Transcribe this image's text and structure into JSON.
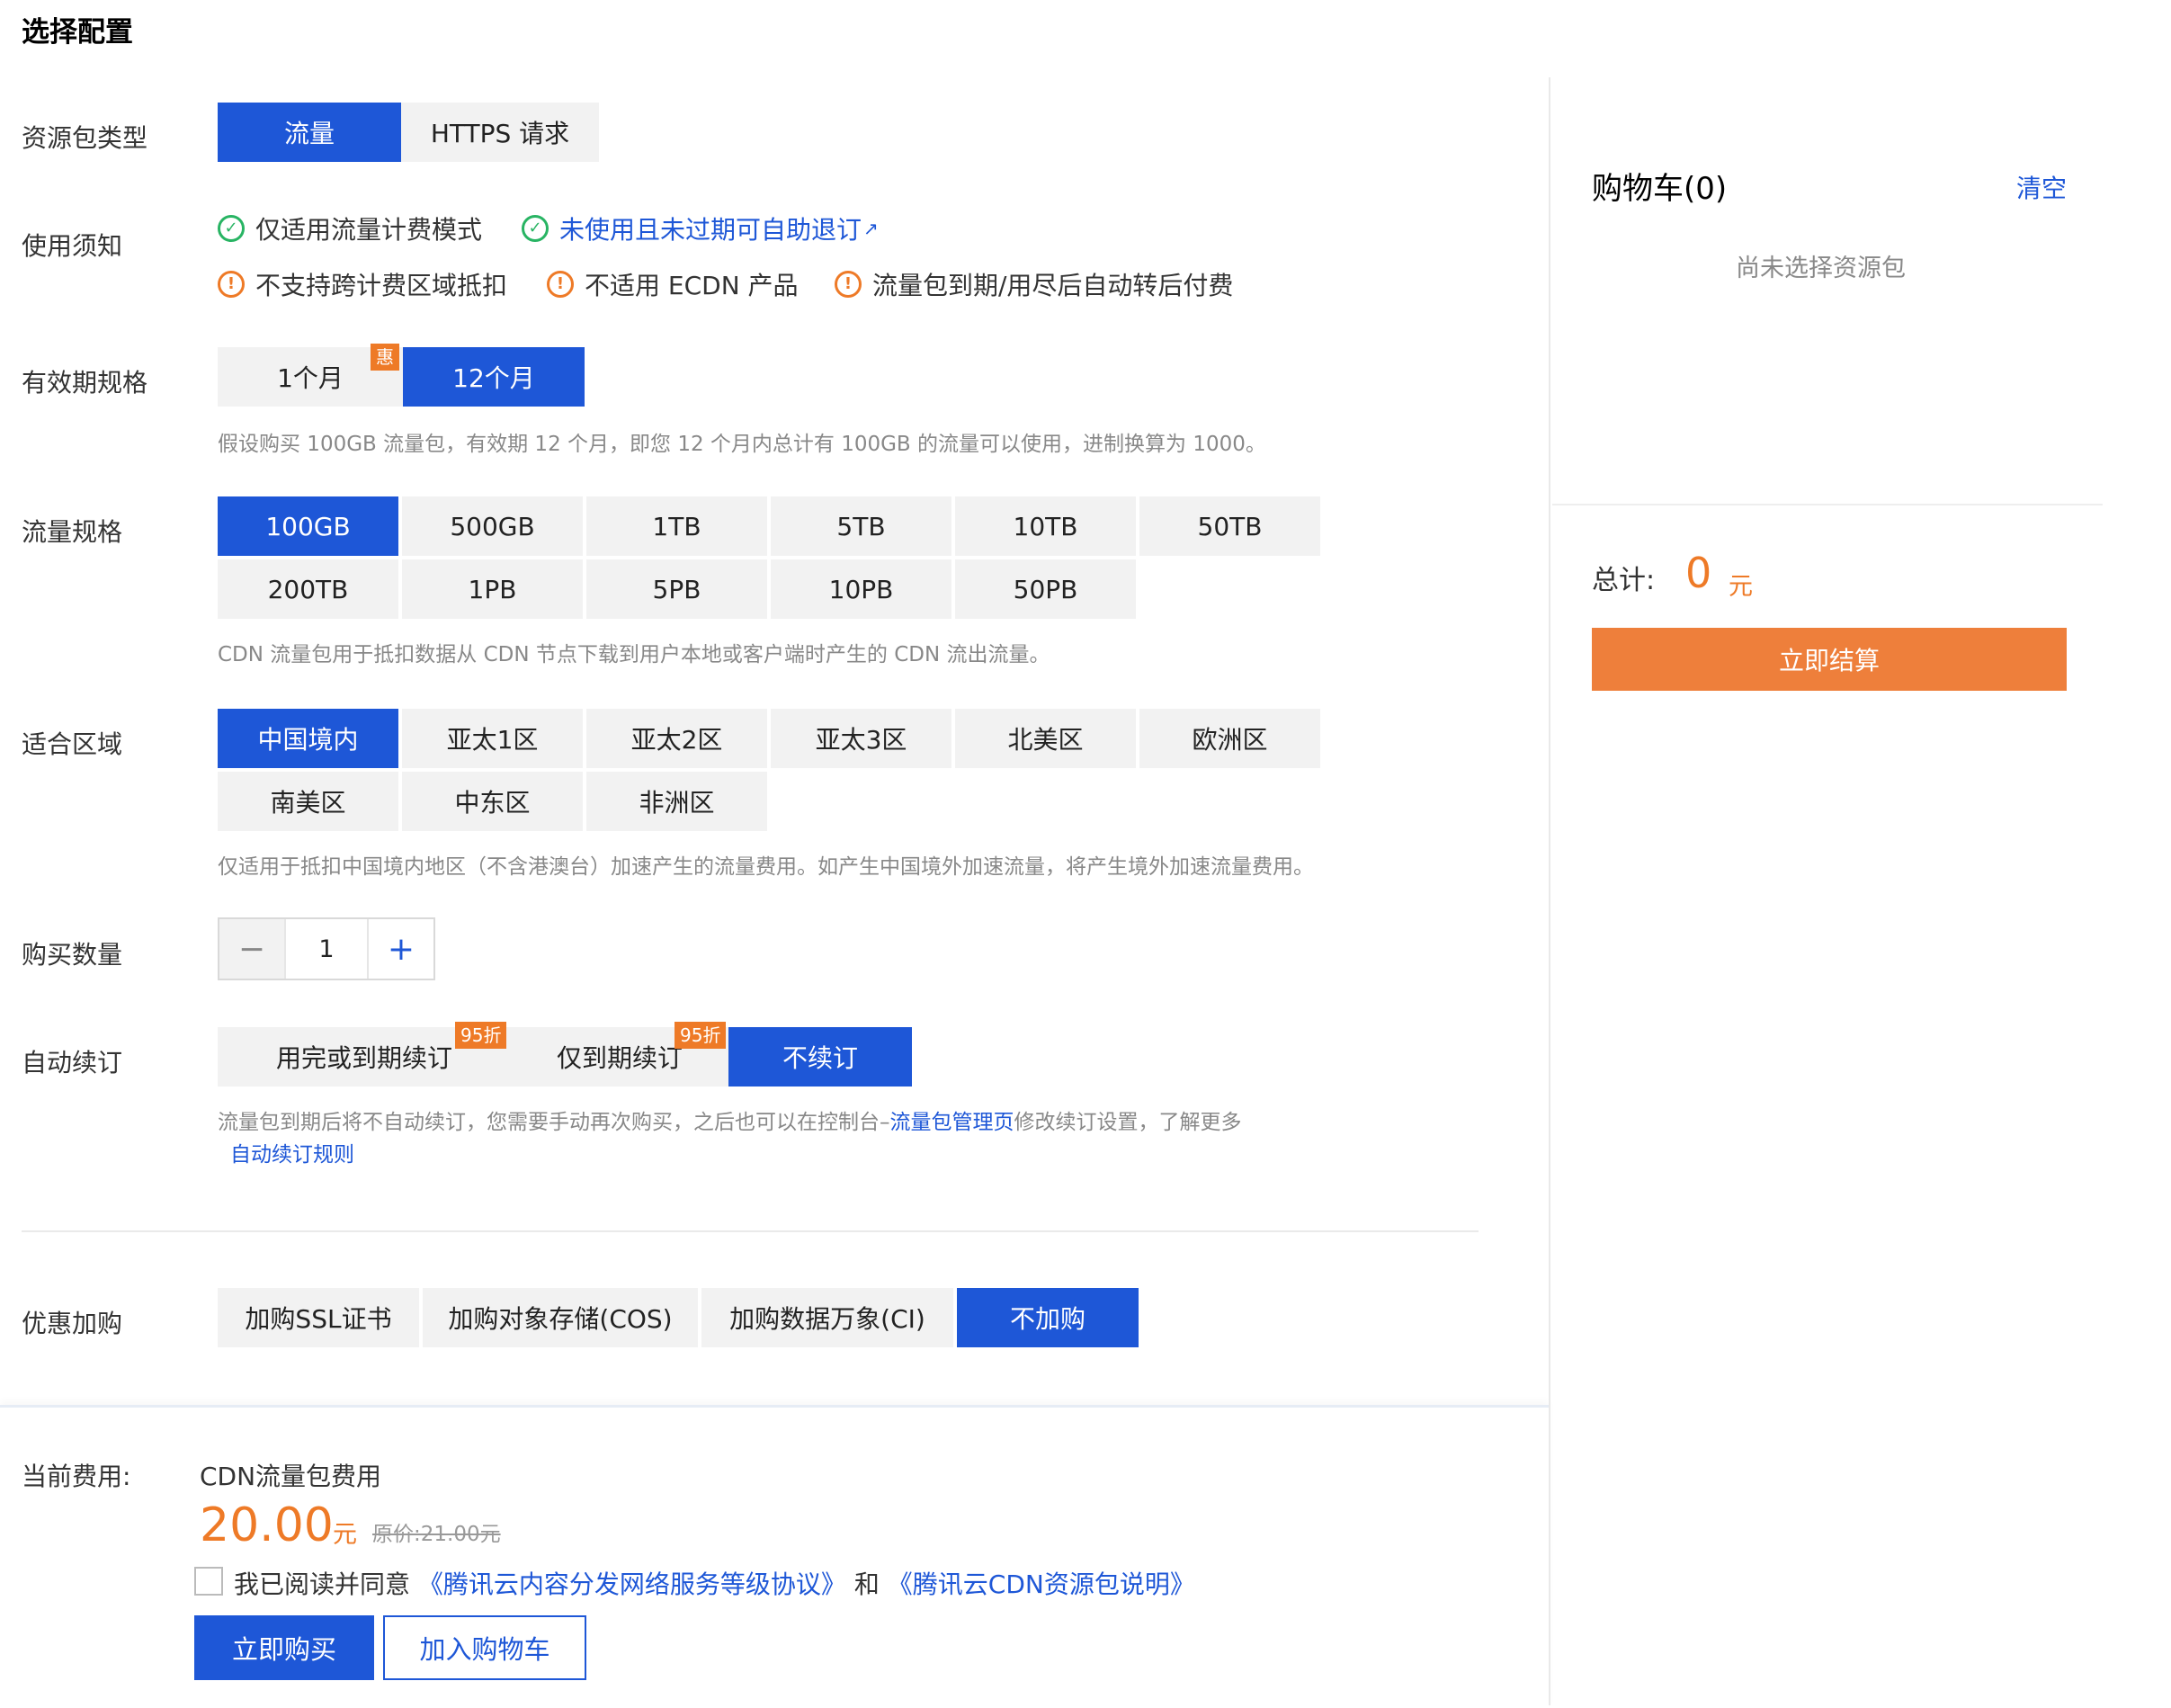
{
  "page_title": "选择配置",
  "package_type": {
    "label": "资源包类型",
    "options": [
      "流量",
      "HTTPS 请求"
    ],
    "selected": "流量"
  },
  "notice": {
    "label": "使用须知",
    "items": [
      {
        "icon": "check-circle-icon",
        "text": "仅适用流量计费模式"
      },
      {
        "icon": "check-circle-icon",
        "text": "未使用且未过期可自助退订",
        "link": true
      },
      {
        "icon": "warning-circle-icon",
        "text": "不支持跨计费区域抵扣"
      },
      {
        "icon": "warning-circle-icon",
        "text": "不适用 ECDN 产品"
      },
      {
        "icon": "warning-circle-icon",
        "text": "流量包到期/用尽后自动转后付费"
      }
    ]
  },
  "validity": {
    "label": "有效期规格",
    "options": [
      "1个月",
      "12个月"
    ],
    "badge": "惠",
    "selected": "12个月",
    "hint": "假设购买 100GB 流量包，有效期 12 个月，即您 12 个月内总计有 100GB 的流量可以使用，进制换算为 1000。"
  },
  "traffic": {
    "label": "流量规格",
    "options": [
      "100GB",
      "500GB",
      "1TB",
      "5TB",
      "10TB",
      "50TB",
      "200TB",
      "1PB",
      "5PB",
      "10PB",
      "50PB"
    ],
    "selected": "100GB",
    "hint": "CDN 流量包用于抵扣数据从 CDN 节点下载到用户本地或客户端时产生的 CDN 流出流量。"
  },
  "region": {
    "label": "适合区域",
    "options": [
      "中国境内",
      "亚太1区",
      "亚太2区",
      "亚太3区",
      "北美区",
      "欧洲区",
      "南美区",
      "中东区",
      "非洲区"
    ],
    "selected": "中国境内",
    "hint": "仅适用于抵扣中国境内地区（不含港澳台）加速产生的流量费用。如产生中国境外加速流量，将产生境外加速流量费用。"
  },
  "quantity": {
    "label": "购买数量",
    "value": "1",
    "minus": "−",
    "plus": "+"
  },
  "renewal": {
    "label": "自动续订",
    "options": [
      "用完或到期续订",
      "仅到期续订",
      "不续订"
    ],
    "badges": [
      "95折",
      "95折"
    ],
    "selected": "不续订",
    "hint_prefix": "流量包到期后将不自动续订，您需要手动再次购买，之后也可以在控制台–",
    "hint_link": "流量包管理页",
    "hint_suffix": "修改续订设置，了解更多",
    "hint_link2": "自动续订规则"
  },
  "addon": {
    "label": "优惠加购",
    "options": [
      "加购SSL证书",
      "加购对象存储(COS)",
      "加购数据万象(CI)",
      "不加购"
    ],
    "selected": "不加购"
  },
  "footer": {
    "cost_label": "当前费用:",
    "item": "CDN流量包费用",
    "price": "20.00",
    "unit": "元",
    "original": "原价:21.00元",
    "agree_text": "我已阅读并同意",
    "agreement1": "《腾讯云内容分发网络服务等级协议》",
    "and": "和",
    "agreement2": "《腾讯云CDN资源包说明》",
    "buy_now": "立即购买",
    "add_cart": "加入购物车"
  },
  "cart": {
    "title": "购物车(0)",
    "clear": "清空",
    "empty": "尚未选择资源包",
    "total_label": "总计:",
    "total_value": "0",
    "total_unit": "元",
    "checkout": "立即结算"
  },
  "colors": {
    "primary": "#1e57d7",
    "accent": "#ee7a27",
    "success": "#28b463"
  }
}
